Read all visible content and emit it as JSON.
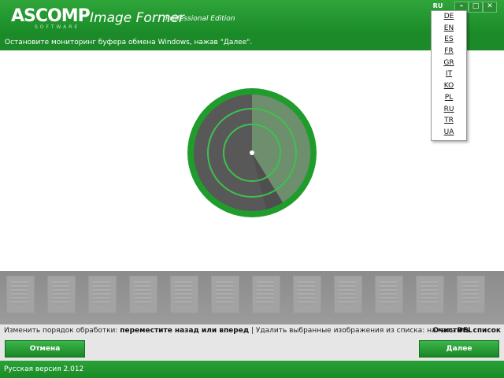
{
  "header": {
    "logo_text": "ASCOMP",
    "logo_sub": "SOFTWARE",
    "app_name": "Image Former",
    "edition": "Professional Edition",
    "language": "RU",
    "buttons": {
      "minimize": "–",
      "maximize": "□",
      "close": "✕"
    },
    "colors": {
      "brand_green": "#1f9a2c"
    }
  },
  "instruction": "Остановите мониторинг буфера обмена Windows, нажав \"Далее\".",
  "radar": {
    "icon": "radar-scan-icon"
  },
  "hints": {
    "part1": "Изменить порядок обработки: ",
    "part1_bold": "переместите назад или вперед",
    "sep": " | ",
    "part2": "Удалить выбранные изображения из списка: нажать ",
    "part2_bold": "DEL",
    "clear_list": "Очистить список"
  },
  "buttons": {
    "cancel": "Отмена",
    "next": "Далее"
  },
  "status": "Русская версия 2.012",
  "language_menu": [
    "DE",
    "EN",
    "ES",
    "FR",
    "GR",
    "IT",
    "KO",
    "PL",
    "RU",
    "TR",
    "UA"
  ]
}
